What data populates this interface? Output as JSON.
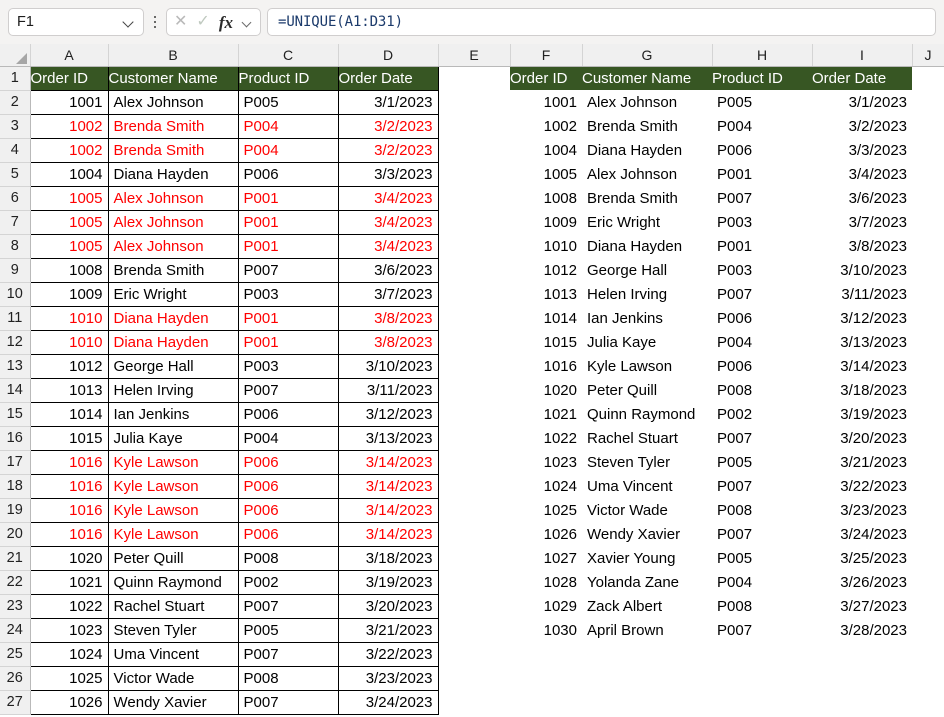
{
  "formula_bar": {
    "name_box_value": "F1",
    "name_box_dropdown_icon": "chevron-down-icon",
    "more_options_icon": "kebab-menu-icon",
    "cancel_icon": "cancel-x-icon",
    "confirm_icon": "confirm-check-icon",
    "function_icon_label": "fx",
    "function_dropdown_icon": "chevron-down-icon",
    "formula_value": "=UNIQUE(A1:D31)",
    "formula_placeholder": ""
  },
  "grid": {
    "column_letters": [
      "A",
      "B",
      "C",
      "D",
      "E",
      "F",
      "G",
      "H",
      "I",
      "J"
    ],
    "row_numbers": [
      "1",
      "2",
      "3",
      "4",
      "5",
      "6",
      "7",
      "8",
      "9",
      "10",
      "11",
      "12",
      "13",
      "14",
      "15",
      "16",
      "17",
      "18",
      "19",
      "20",
      "21",
      "22",
      "23",
      "24",
      "25",
      "26",
      "27"
    ],
    "select_all_icon": "select-all-triangle-icon"
  },
  "colors": {
    "header_green": "#375623",
    "header_text": "#ffffff",
    "duplicate_red": "#ff0000",
    "grid_line": "#d4d4d4",
    "row_header_bg": "#f0f0f0",
    "formula_text": "#1b3a6b"
  },
  "source_table": {
    "headers": [
      "Order ID",
      "Customer Name",
      "Product ID",
      "Order Date"
    ],
    "rows": [
      {
        "order_id": "1001",
        "customer": "Alex Johnson",
        "product": "P005",
        "date": "3/1/2023",
        "duplicate": false
      },
      {
        "order_id": "1002",
        "customer": "Brenda Smith",
        "product": "P004",
        "date": "3/2/2023",
        "duplicate": true
      },
      {
        "order_id": "1002",
        "customer": "Brenda Smith",
        "product": "P004",
        "date": "3/2/2023",
        "duplicate": true
      },
      {
        "order_id": "1004",
        "customer": "Diana Hayden",
        "product": "P006",
        "date": "3/3/2023",
        "duplicate": false
      },
      {
        "order_id": "1005",
        "customer": "Alex Johnson",
        "product": "P001",
        "date": "3/4/2023",
        "duplicate": true
      },
      {
        "order_id": "1005",
        "customer": "Alex Johnson",
        "product": "P001",
        "date": "3/4/2023",
        "duplicate": true
      },
      {
        "order_id": "1005",
        "customer": "Alex Johnson",
        "product": "P001",
        "date": "3/4/2023",
        "duplicate": true
      },
      {
        "order_id": "1008",
        "customer": "Brenda Smith",
        "product": "P007",
        "date": "3/6/2023",
        "duplicate": false
      },
      {
        "order_id": "1009",
        "customer": "Eric Wright",
        "product": "P003",
        "date": "3/7/2023",
        "duplicate": false
      },
      {
        "order_id": "1010",
        "customer": "Diana Hayden",
        "product": "P001",
        "date": "3/8/2023",
        "duplicate": true
      },
      {
        "order_id": "1010",
        "customer": "Diana Hayden",
        "product": "P001",
        "date": "3/8/2023",
        "duplicate": true
      },
      {
        "order_id": "1012",
        "customer": "George Hall",
        "product": "P003",
        "date": "3/10/2023",
        "duplicate": false
      },
      {
        "order_id": "1013",
        "customer": "Helen Irving",
        "product": "P007",
        "date": "3/11/2023",
        "duplicate": false
      },
      {
        "order_id": "1014",
        "customer": "Ian Jenkins",
        "product": "P006",
        "date": "3/12/2023",
        "duplicate": false
      },
      {
        "order_id": "1015",
        "customer": "Julia Kaye",
        "product": "P004",
        "date": "3/13/2023",
        "duplicate": false
      },
      {
        "order_id": "1016",
        "customer": "Kyle Lawson",
        "product": "P006",
        "date": "3/14/2023",
        "duplicate": true
      },
      {
        "order_id": "1016",
        "customer": "Kyle Lawson",
        "product": "P006",
        "date": "3/14/2023",
        "duplicate": true
      },
      {
        "order_id": "1016",
        "customer": "Kyle Lawson",
        "product": "P006",
        "date": "3/14/2023",
        "duplicate": true
      },
      {
        "order_id": "1016",
        "customer": "Kyle Lawson",
        "product": "P006",
        "date": "3/14/2023",
        "duplicate": true
      },
      {
        "order_id": "1020",
        "customer": "Peter Quill",
        "product": "P008",
        "date": "3/18/2023",
        "duplicate": false
      },
      {
        "order_id": "1021",
        "customer": "Quinn Raymond",
        "product": "P002",
        "date": "3/19/2023",
        "duplicate": false
      },
      {
        "order_id": "1022",
        "customer": "Rachel Stuart",
        "product": "P007",
        "date": "3/20/2023",
        "duplicate": false
      },
      {
        "order_id": "1023",
        "customer": "Steven Tyler",
        "product": "P005",
        "date": "3/21/2023",
        "duplicate": false
      },
      {
        "order_id": "1024",
        "customer": "Uma Vincent",
        "product": "P007",
        "date": "3/22/2023",
        "duplicate": false
      },
      {
        "order_id": "1025",
        "customer": "Victor Wade",
        "product": "P008",
        "date": "3/23/2023",
        "duplicate": false
      },
      {
        "order_id": "1026",
        "customer": "Wendy Xavier",
        "product": "P007",
        "date": "3/24/2023",
        "duplicate": false
      }
    ]
  },
  "result_table": {
    "headers": [
      "Order ID",
      "Customer Name",
      "Product ID",
      "Order Date"
    ],
    "rows": [
      {
        "order_id": "1001",
        "customer": "Alex Johnson",
        "product": "P005",
        "date": "3/1/2023"
      },
      {
        "order_id": "1002",
        "customer": "Brenda Smith",
        "product": "P004",
        "date": "3/2/2023"
      },
      {
        "order_id": "1004",
        "customer": "Diana Hayden",
        "product": "P006",
        "date": "3/3/2023"
      },
      {
        "order_id": "1005",
        "customer": "Alex Johnson",
        "product": "P001",
        "date": "3/4/2023"
      },
      {
        "order_id": "1008",
        "customer": "Brenda Smith",
        "product": "P007",
        "date": "3/6/2023"
      },
      {
        "order_id": "1009",
        "customer": "Eric Wright",
        "product": "P003",
        "date": "3/7/2023"
      },
      {
        "order_id": "1010",
        "customer": "Diana Hayden",
        "product": "P001",
        "date": "3/8/2023"
      },
      {
        "order_id": "1012",
        "customer": "George Hall",
        "product": "P003",
        "date": "3/10/2023"
      },
      {
        "order_id": "1013",
        "customer": "Helen Irving",
        "product": "P007",
        "date": "3/11/2023"
      },
      {
        "order_id": "1014",
        "customer": "Ian Jenkins",
        "product": "P006",
        "date": "3/12/2023"
      },
      {
        "order_id": "1015",
        "customer": "Julia Kaye",
        "product": "P004",
        "date": "3/13/2023"
      },
      {
        "order_id": "1016",
        "customer": "Kyle Lawson",
        "product": "P006",
        "date": "3/14/2023"
      },
      {
        "order_id": "1020",
        "customer": "Peter Quill",
        "product": "P008",
        "date": "3/18/2023"
      },
      {
        "order_id": "1021",
        "customer": "Quinn Raymond",
        "product": "P002",
        "date": "3/19/2023"
      },
      {
        "order_id": "1022",
        "customer": "Rachel Stuart",
        "product": "P007",
        "date": "3/20/2023"
      },
      {
        "order_id": "1023",
        "customer": "Steven Tyler",
        "product": "P005",
        "date": "3/21/2023"
      },
      {
        "order_id": "1024",
        "customer": "Uma Vincent",
        "product": "P007",
        "date": "3/22/2023"
      },
      {
        "order_id": "1025",
        "customer": "Victor Wade",
        "product": "P008",
        "date": "3/23/2023"
      },
      {
        "order_id": "1026",
        "customer": "Wendy Xavier",
        "product": "P007",
        "date": "3/24/2023"
      },
      {
        "order_id": "1027",
        "customer": "Xavier Young",
        "product": "P005",
        "date": "3/25/2023"
      },
      {
        "order_id": "1028",
        "customer": "Yolanda Zane",
        "product": "P004",
        "date": "3/26/2023"
      },
      {
        "order_id": "1029",
        "customer": "Zack Albert",
        "product": "P008",
        "date": "3/27/2023"
      },
      {
        "order_id": "1030",
        "customer": "April Brown",
        "product": "P007",
        "date": "3/28/2023"
      }
    ]
  }
}
